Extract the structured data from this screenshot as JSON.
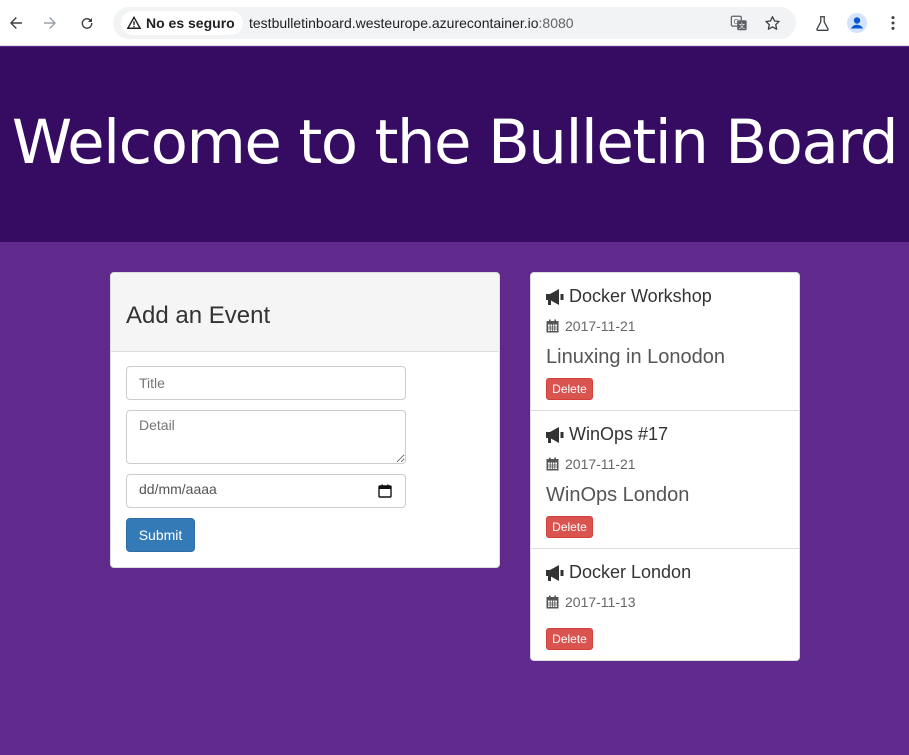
{
  "browser": {
    "security_label": "No es seguro",
    "url_host": "testbulletinboard.westeurope.azurecontainer.io",
    "url_port": ":8080"
  },
  "page": {
    "heading": "Welcome to the Bulletin Board"
  },
  "add_event": {
    "heading": "Add an Event",
    "title_placeholder": "Title",
    "detail_placeholder": "Detail",
    "date_placeholder": "dd/mm/aaaa",
    "submit_label": "Submit"
  },
  "events": [
    {
      "title": "Docker Workshop",
      "date": "2017-11-21",
      "detail": "Linuxing in Lonodon",
      "delete_label": "Delete"
    },
    {
      "title": "WinOps #17",
      "date": "2017-11-21",
      "detail": "WinOps London",
      "delete_label": "Delete"
    },
    {
      "title": "Docker London",
      "date": "2017-11-13",
      "detail": "",
      "delete_label": "Delete"
    }
  ],
  "colors": {
    "jumbotron": "#360c63",
    "background": "#5f2a8c",
    "primary": "#337ab7",
    "danger": "#d9534f"
  },
  "icons": {
    "event": "bullhorn-icon",
    "date": "calendar-icon"
  }
}
